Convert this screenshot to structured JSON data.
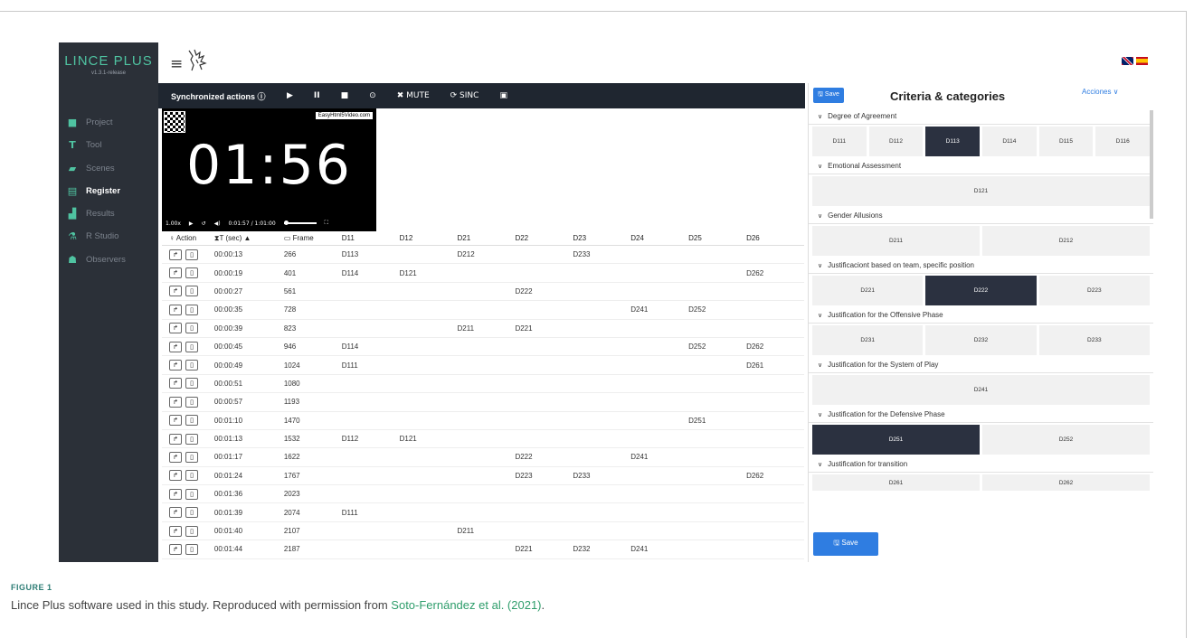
{
  "sidebar": {
    "brand": "LINCE PLUS",
    "version": "v1.3.1-release",
    "items": [
      {
        "label": "Project",
        "icon": "briefcase-icon",
        "glyph": "■",
        "active": false
      },
      {
        "label": "Tool",
        "icon": "tool-icon",
        "glyph": "T",
        "active": false
      },
      {
        "label": "Scenes",
        "icon": "scenes-icon",
        "glyph": "▰",
        "active": false
      },
      {
        "label": "Register",
        "icon": "register-icon",
        "glyph": "▤",
        "active": true
      },
      {
        "label": "Results",
        "icon": "results-icon",
        "glyph": "▟",
        "active": false
      },
      {
        "label": "R Studio",
        "icon": "flask-icon",
        "glyph": "⚗",
        "active": false
      },
      {
        "label": "Observers",
        "icon": "users-icon",
        "glyph": "☗",
        "active": false
      }
    ]
  },
  "toolbar": {
    "title": "Synchronized actions ⓘ",
    "play": "▶",
    "pause": "II",
    "stop": "■",
    "target": "⊙",
    "mute": "✖ MUTE",
    "sync": "⟳ SINC",
    "film": "▣"
  },
  "video": {
    "watermark": "EasyHtml5Video.com",
    "clock": "01:56",
    "speed": "1.00x",
    "time": "0:01:57 / 1:01:00"
  },
  "table": {
    "headers": [
      "♀ Action",
      "⧗T (sec) ▲",
      "▭ Frame",
      "D11",
      "D12",
      "D21",
      "D22",
      "D23",
      "D24",
      "D25",
      "D26"
    ],
    "rows": [
      [
        "00:00:13",
        "266",
        "D113",
        "",
        "D212",
        "",
        "D233",
        "",
        "",
        ""
      ],
      [
        "00:00:19",
        "401",
        "D114",
        "D121",
        "",
        "",
        "",
        "",
        "",
        "D262"
      ],
      [
        "00:00:27",
        "561",
        "",
        "",
        "",
        "D222",
        "",
        "",
        "",
        ""
      ],
      [
        "00:00:35",
        "728",
        "",
        "",
        "",
        "",
        "",
        "D241",
        "D252",
        ""
      ],
      [
        "00:00:39",
        "823",
        "",
        "",
        "D211",
        "D221",
        "",
        "",
        "",
        ""
      ],
      [
        "00:00:45",
        "946",
        "D114",
        "",
        "",
        "",
        "",
        "",
        "D252",
        "D262"
      ],
      [
        "00:00:49",
        "1024",
        "D111",
        "",
        "",
        "",
        "",
        "",
        "",
        "D261"
      ],
      [
        "00:00:51",
        "1080",
        "",
        "",
        "",
        "",
        "",
        "",
        "",
        ""
      ],
      [
        "00:00:57",
        "1193",
        "",
        "",
        "",
        "",
        "",
        "",
        "",
        ""
      ],
      [
        "00:01:10",
        "1470",
        "",
        "",
        "",
        "",
        "",
        "",
        "D251",
        ""
      ],
      [
        "00:01:13",
        "1532",
        "D112",
        "D121",
        "",
        "",
        "",
        "",
        "",
        ""
      ],
      [
        "00:01:17",
        "1622",
        "",
        "",
        "",
        "D222",
        "",
        "D241",
        "",
        ""
      ],
      [
        "00:01:24",
        "1767",
        "",
        "",
        "",
        "D223",
        "D233",
        "",
        "",
        "D262"
      ],
      [
        "00:01:36",
        "2023",
        "",
        "",
        "",
        "",
        "",
        "",
        "",
        ""
      ],
      [
        "00:01:39",
        "2074",
        "D111",
        "",
        "",
        "",
        "",
        "",
        "",
        ""
      ],
      [
        "00:01:40",
        "2107",
        "",
        "",
        "D211",
        "",
        "",
        "",
        "",
        ""
      ],
      [
        "00:01:44",
        "2187",
        "",
        "",
        "",
        "D221",
        "D232",
        "D241",
        "",
        ""
      ]
    ]
  },
  "panel": {
    "save_label": "🖫 Save",
    "title": "Criteria & categories",
    "acciones": "Acciones ∨",
    "groups": [
      {
        "name": "Degree of Agreement",
        "cats": [
          "D111",
          "D112",
          "D113",
          "D114",
          "D115",
          "D116"
        ],
        "selected": "D113"
      },
      {
        "name": "Emotional Assessment",
        "cats": [
          "D121"
        ],
        "selected": ""
      },
      {
        "name": "Gender Allusions",
        "cats": [
          "D211",
          "D212"
        ],
        "selected": ""
      },
      {
        "name": "Justificaciont based on team, specific position",
        "cats": [
          "D221",
          "D222",
          "D223"
        ],
        "selected": "D222"
      },
      {
        "name": "Justification for the Offensive Phase",
        "cats": [
          "D231",
          "D232",
          "D233"
        ],
        "selected": ""
      },
      {
        "name": "Justification for the System of Play",
        "cats": [
          "D241"
        ],
        "selected": ""
      },
      {
        "name": "Justification for the Defensive Phase",
        "cats": [
          "D251",
          "D252"
        ],
        "selected": "D251"
      },
      {
        "name": "Justification for transition",
        "cats": [
          "D261",
          "D262"
        ],
        "selected": ""
      }
    ],
    "save_bottom": "🖫 Save"
  },
  "caption": {
    "label": "FIGURE 1",
    "text_before": "Lince Plus software used in this study. Reproduced with permission from ",
    "link": "Soto-Fernández et al. (2021)",
    "text_after": "."
  },
  "colors": {
    "sidebar_bg": "#2b3038",
    "accent": "#4fc3a1",
    "selected": "#2b3140",
    "button": "#2f7de1"
  }
}
